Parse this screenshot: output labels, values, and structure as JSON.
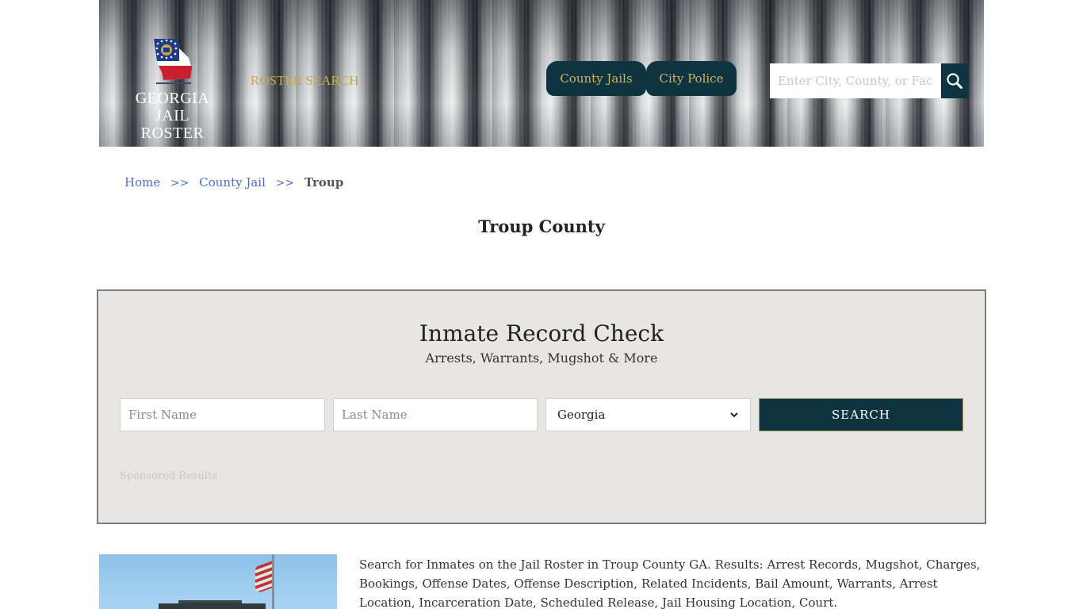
{
  "header": {
    "logo_text_line1": "GEORGIA",
    "logo_text_line2": "JAIL ROSTER",
    "roster_search_link": "ROSTER SEARCH",
    "nav_tabs": [
      {
        "label": "County Jails"
      },
      {
        "label": "City Police"
      }
    ],
    "search": {
      "placeholder": "Enter City, County, or Facility",
      "value": ""
    },
    "colors": {
      "nav_bg": "#0d3440",
      "nav_text": "#d4b35a",
      "roster_link": "#c9a74b"
    }
  },
  "breadcrumb": {
    "items": [
      {
        "label": "Home"
      },
      {
        "label": "County Jail"
      },
      {
        "label": "Troup"
      }
    ],
    "separator": ">>"
  },
  "page": {
    "title": "Troup County"
  },
  "record_check": {
    "title": "Inmate Record Check",
    "subtitle": "Arrests, Warrants, Mugshot & More",
    "first_name_placeholder": "First Name",
    "last_name_placeholder": "Last Name",
    "state_selected": "Georgia",
    "search_button": "SEARCH",
    "sponsored_label": "Sponsored Results"
  },
  "content": {
    "description": "Search for Inmates on the Jail Roster in Troup County GA. Results: Arrest Records, Mugshot, Charges, Bookings, Offense Dates, Offense Description, Related Incidents, Bail Amount, Warrants, Arrest Location, Incarceration Date, Scheduled Release, Jail Housing Location, Court."
  }
}
